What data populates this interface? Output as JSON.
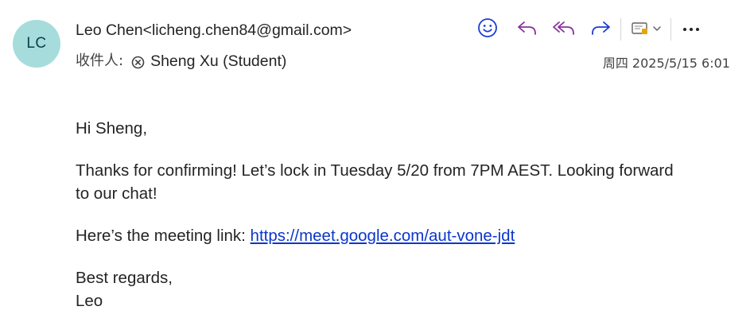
{
  "header": {
    "avatar_initials": "LC",
    "sender": "Leo Chen<licheng.chen84@gmail.com>",
    "to_label": "收件人:",
    "recipient": "Sheng Xu (Student)",
    "date": "周四 2025/5/15 6:01"
  },
  "toolbar": {
    "icons": [
      "emoji-icon",
      "reply-icon",
      "reply-all-icon",
      "forward-icon",
      "apps-icon",
      "chevron-down-icon",
      "more-icon"
    ]
  },
  "message": {
    "greeting": "Hi Sheng,",
    "line1": "Thanks for confirming! Let’s lock in Tuesday 5/20 from 7PM AEST. Looking forward to our chat!",
    "link_prefix": "Here’s the meeting link: ",
    "link_text": "https://meet.google.com/aut-vone-jdt",
    "closing": "Best regards,",
    "signature": "Leo"
  },
  "colors": {
    "accent_blue": "#1a3ccf",
    "purple": "#8a2f9c",
    "link": "#0b36cc",
    "avatar_bg": "#a6dcdc"
  }
}
